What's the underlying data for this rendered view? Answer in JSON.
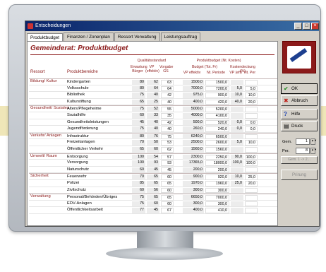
{
  "window": {
    "title": "Entscheidungen",
    "min_label": "_",
    "max_label": "□",
    "close_label": "×"
  },
  "tabs": [
    "Produktbudget",
    "Finanzen / Zonenplan",
    "Ressort Verwaltung",
    "Leistungsauftrag"
  ],
  "heading": "Gemeinderat: Produktbudget",
  "columns": {
    "ressort": "Ressort",
    "bereiche": "Produktbereiche",
    "qualitaet": "Qualitätsstandard",
    "budget": "Produktbudget (Nt. Kosten)",
    "erwartung": "Erwartung Bürger",
    "vp": "VP (effektiv)",
    "vorgabe": "Vorgabe GS",
    "budget_fr": "Budget (Tot. Fr)",
    "kostendeckung": "Kostendeckung (%)",
    "vp_effektiv": "VP effektiv",
    "nt_periode": "Nt. Periode",
    "vp_eff": "VP (eff)",
    "nt_per": "Nt. Per"
  },
  "rows": [
    {
      "ressort": "Bildung/ Kultur",
      "bereich": "Kindergarten",
      "v": [
        "80",
        "62",
        "63",
        "1500,0",
        "1500,0",
        "",
        ""
      ]
    },
    {
      "ressort": "",
      "bereich": "Volksschule",
      "v": [
        "80",
        "64",
        "64",
        "7000,0",
        "7200,0",
        "5,0",
        "5,0"
      ]
    },
    {
      "ressort": "",
      "bereich": "Bibliothek",
      "v": [
        "75",
        "40",
        "42",
        "975,0",
        "900,0",
        "10,0",
        "10,0"
      ]
    },
    {
      "ressort": "",
      "bereich": "Kulturstiftung",
      "v": [
        "65",
        "25",
        "40",
        "400,0",
        "420,0",
        "40,0",
        "20,0"
      ]
    },
    {
      "ressort": "Gesundheit/ Soziales",
      "bereich": "Alters/Pflegeheime",
      "v": [
        "75",
        "52",
        "55",
        "5000,0",
        "5200,0",
        "",
        ""
      ]
    },
    {
      "ressort": "",
      "bereich": "Sozialhilfe",
      "v": [
        "60",
        "33",
        "35",
        "4000,0",
        "4100,0",
        "",
        ""
      ]
    },
    {
      "ressort": "",
      "bereich": "Gesundheitsleistungen",
      "v": [
        "45",
        "40",
        "42",
        "500,0",
        "520,0",
        "0,0",
        "0,0"
      ]
    },
    {
      "ressort": "",
      "bereich": "Jugendförderung",
      "v": [
        "75",
        "40",
        "40",
        "260,0",
        "240,0",
        "0,0",
        "0,0"
      ]
    },
    {
      "ressort": "Verkehr/ Anlagen",
      "bereich": "Infrastruktur",
      "v": [
        "80",
        "76",
        "75",
        "6240,0",
        "6500,0",
        "",
        ""
      ]
    },
    {
      "ressort": "",
      "bereich": "Freizeitanlagen",
      "v": [
        "70",
        "50",
        "53",
        "2500,0",
        "2600,0",
        "5,0",
        "10,0"
      ]
    },
    {
      "ressort": "",
      "bereich": "Öffentlicher Verkehr",
      "v": [
        "65",
        "60",
        "62",
        "1560,0",
        "1560,0",
        "",
        ""
      ]
    },
    {
      "ressort": "Umwelt/ Raum",
      "bereich": "Entsorgung",
      "v": [
        "100",
        "54",
        "57",
        "2300,0",
        "2250,0",
        "90,0",
        "100,0"
      ]
    },
    {
      "ressort": "",
      "bereich": "Versorgung",
      "v": [
        "100",
        "93",
        "93",
        "17365,0",
        "18000,0",
        "100,0",
        "100,0"
      ]
    },
    {
      "ressort": "",
      "bereich": "Naturschutz",
      "v": [
        "60",
        "45",
        "45",
        "200,0",
        "200,0",
        "",
        ""
      ]
    },
    {
      "ressort": "Sicherheit",
      "bereich": "Feuerwehr",
      "v": [
        "70",
        "65",
        "60",
        "900,0",
        "920,0",
        "10,0",
        "25,0"
      ]
    },
    {
      "ressort": "",
      "bereich": "Polizei",
      "v": [
        "85",
        "65",
        "65",
        "1970,0",
        "1960,0",
        "25,0",
        "20,0"
      ]
    },
    {
      "ressort": "",
      "bereich": "Zivilschutz",
      "v": [
        "60",
        "56",
        "60",
        "300,0",
        "300,0",
        "",
        ""
      ]
    },
    {
      "ressort": "Verwaltung",
      "bereich": "Personal/Behörden/Übriges",
      "v": [
        "75",
        "65",
        "65",
        "6650,0",
        "7000,0",
        "",
        ""
      ]
    },
    {
      "ressort": "",
      "bereich": "EDV-Anlagen",
      "v": [
        "75",
        "60",
        "60",
        "300,0",
        "300,0",
        "",
        ""
      ]
    },
    {
      "ressort": "",
      "bereich": "Öffentlichkeitsarbeit",
      "v": [
        "77",
        "45",
        "67",
        "400,0",
        "410,0",
        "",
        ""
      ]
    }
  ],
  "side": {
    "ok": "OK",
    "abbruch": "Abbruch",
    "hilfe": "Hilfe",
    "druck": "Druck",
    "gem_label": "Gem.",
    "gem_value": "1",
    "per_label": "Per.",
    "per_value": "8",
    "switch_label": "Gem. 1 -> 2...",
    "prirung": "Prirung"
  },
  "colors": {
    "accent": "#8b1a1a",
    "titlebar": "#0a246a"
  }
}
